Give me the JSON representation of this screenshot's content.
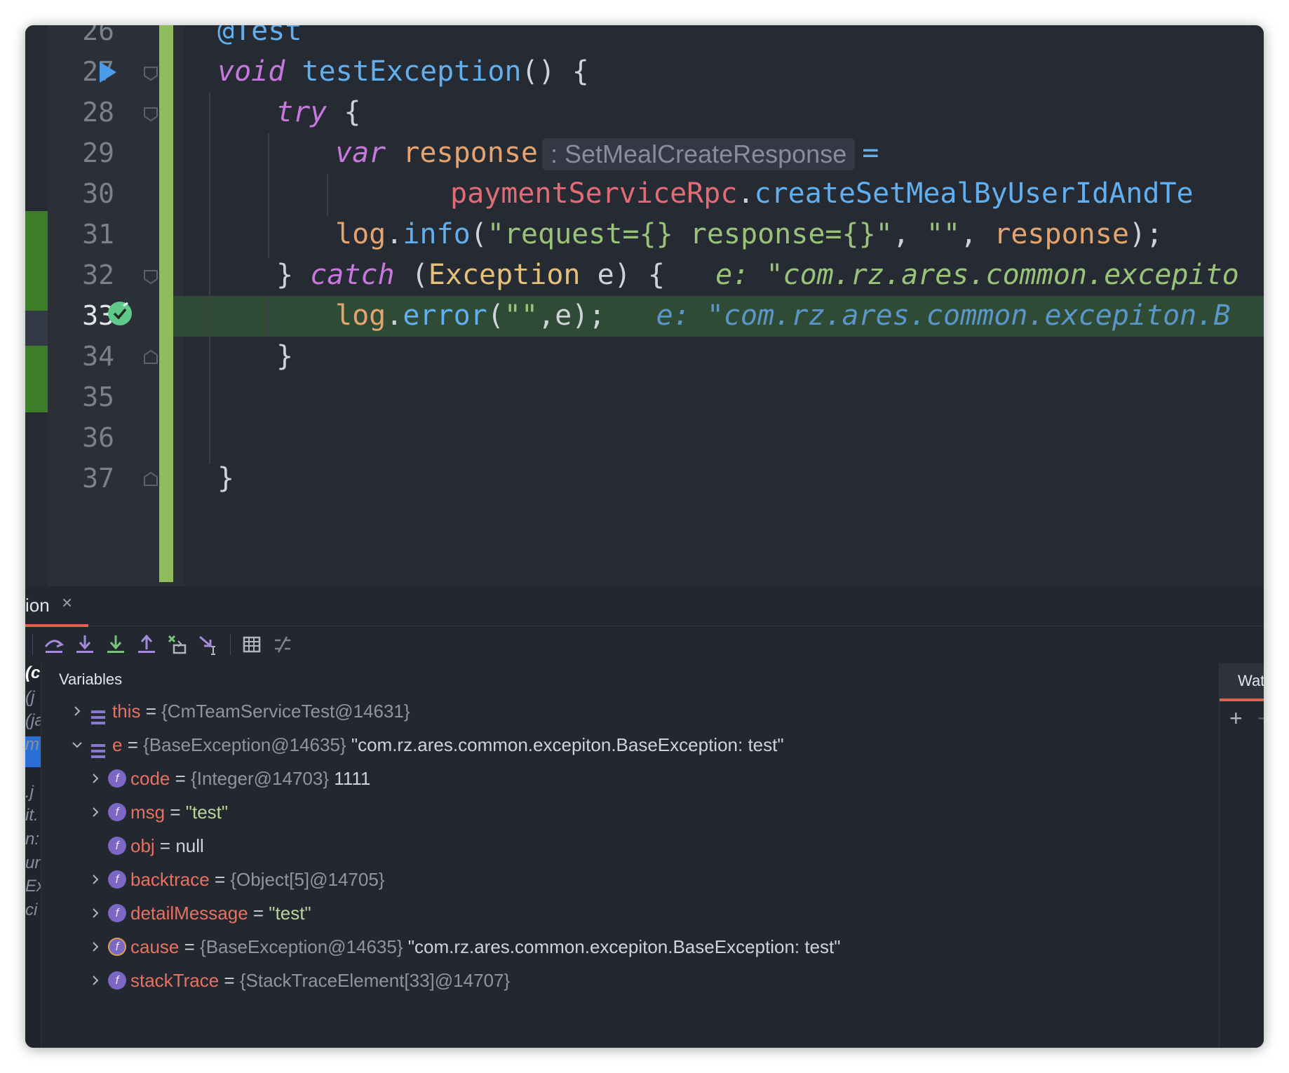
{
  "editor": {
    "lines": [
      {
        "num": "26",
        "tokens": [
          {
            "t": "@Test",
            "c": "ann"
          }
        ]
      },
      {
        "num": "27",
        "tokens": [
          {
            "t": "void",
            "c": "kw"
          },
          {
            "t": " ",
            "c": "punct"
          },
          {
            "t": "testException",
            "c": "fn"
          },
          {
            "t": "() {",
            "c": "punct"
          }
        ]
      },
      {
        "num": "28",
        "tokens": [
          {
            "t": "try",
            "c": "kw"
          },
          {
            "t": " {",
            "c": "punct"
          }
        ]
      },
      {
        "num": "29",
        "tokens": [
          {
            "t": "var",
            "c": "kw"
          },
          {
            "t": " ",
            "c": "punct"
          },
          {
            "t": "response",
            "c": "var"
          }
        ],
        "type_hint": ": SetMealCreateResponse",
        "after_hint": "=",
        "after_hint_color": "#61afef"
      },
      {
        "num": "30",
        "tokens": [
          {
            "t": "paymentServiceRpc",
            "c": "field"
          },
          {
            "t": ".",
            "c": "punct"
          },
          {
            "t": "createSetMealByUserIdAndTe",
            "c": "fn"
          }
        ]
      },
      {
        "num": "31",
        "tokens": [
          {
            "t": "log",
            "c": "var"
          },
          {
            "t": ".",
            "c": "punct"
          },
          {
            "t": "info",
            "c": "fn"
          },
          {
            "t": "(",
            "c": "punct"
          },
          {
            "t": "\"request={} response={}\"",
            "c": "str"
          },
          {
            "t": ", ",
            "c": "punct"
          },
          {
            "t": "\"\"",
            "c": "str"
          },
          {
            "t": ", ",
            "c": "punct"
          },
          {
            "t": "response",
            "c": "var"
          },
          {
            "t": ");",
            "c": "punct"
          }
        ]
      },
      {
        "num": "32",
        "tokens": [
          {
            "t": "} ",
            "c": "punct"
          },
          {
            "t": "catch",
            "c": "kw"
          },
          {
            "t": " (",
            "c": "punct"
          },
          {
            "t": "Exception",
            "c": "cls"
          },
          {
            "t": " e) {",
            "c": "punct"
          },
          {
            "t": "   e: \"com.rz.ares.common.excepito",
            "c": "hint-inline"
          }
        ]
      },
      {
        "num": "33",
        "tokens": [
          {
            "t": "log",
            "c": "var"
          },
          {
            "t": ".",
            "c": "punct"
          },
          {
            "t": "error",
            "c": "fn"
          },
          {
            "t": "(",
            "c": "punct"
          },
          {
            "t": "\"\"",
            "c": "str"
          },
          {
            "t": ",e);",
            "c": "punct"
          },
          {
            "t": "   e: \"com.rz.ares.common.excepiton.B",
            "c": "hint-blue"
          }
        ]
      },
      {
        "num": "34",
        "tokens": [
          {
            "t": "}",
            "c": "punct"
          }
        ]
      },
      {
        "num": "35",
        "tokens": []
      },
      {
        "num": "36",
        "tokens": []
      },
      {
        "num": "37",
        "tokens": [
          {
            "t": "}",
            "c": "punct"
          }
        ]
      }
    ]
  },
  "debug": {
    "tab_label": "ion",
    "tab_close": "×",
    "toolbar": [
      "step-over-icon",
      "step-into-icon",
      "force-step-into-icon",
      "step-out-icon",
      "drop-frame-icon",
      "run-to-cursor-icon",
      "evaluate-table-icon",
      "trace-stream-icon"
    ],
    "variables_header": "Variables",
    "rail_fragments": [
      "(c",
      "(j",
      "(ja",
      "m",
      ".j",
      "it.",
      "n:",
      "un",
      "Ex",
      "ci"
    ],
    "variables": [
      {
        "level": 0,
        "expandable": true,
        "expanded": false,
        "icon": "lines",
        "name": "this",
        "eq": " = ",
        "obj": "{CmTeamServiceTest@14631}",
        "value": "",
        "value_kind": "plain"
      },
      {
        "level": 0,
        "expandable": true,
        "expanded": true,
        "icon": "lines",
        "name": "e",
        "eq": " = ",
        "obj": "{BaseException@14635}",
        "value": " \"com.rz.ares.common.excepiton.BaseException: test\"",
        "value_kind": "plain"
      },
      {
        "level": 1,
        "expandable": true,
        "expanded": false,
        "icon": "field",
        "name": "code",
        "eq": " = ",
        "obj": "{Integer@14703}",
        "value": " 1111",
        "value_kind": "plain"
      },
      {
        "level": 1,
        "expandable": true,
        "expanded": false,
        "icon": "field",
        "name": "msg",
        "eq": " = ",
        "obj": "",
        "value": "\"test\"",
        "value_kind": "str"
      },
      {
        "level": 1,
        "expandable": false,
        "expanded": false,
        "icon": "field",
        "name": "obj",
        "eq": " = ",
        "obj": "",
        "value": "null",
        "value_kind": "plain"
      },
      {
        "level": 1,
        "expandable": true,
        "expanded": false,
        "icon": "field",
        "name": "backtrace",
        "eq": " = ",
        "obj": "{Object[5]@14705}",
        "value": "",
        "value_kind": "plain"
      },
      {
        "level": 1,
        "expandable": true,
        "expanded": false,
        "icon": "field",
        "name": "detailMessage",
        "eq": " = ",
        "obj": "",
        "value": "\"test\"",
        "value_kind": "str"
      },
      {
        "level": 1,
        "expandable": true,
        "expanded": false,
        "icon": "field-alt",
        "name": "cause",
        "eq": " = ",
        "obj": "{BaseException@14635}",
        "value": " \"com.rz.ares.common.excepiton.BaseException: test\"",
        "value_kind": "plain"
      },
      {
        "level": 1,
        "expandable": true,
        "expanded": false,
        "icon": "field",
        "name": "stackTrace",
        "eq": " = ",
        "obj": "{StackTraceElement[33]@14707}",
        "value": "",
        "value_kind": "plain"
      }
    ],
    "field_icon_letter": "f",
    "watches_label": "Watches",
    "watch_add": "+",
    "watch_remove": "−"
  },
  "colors": {
    "editor_bg": "#262a33",
    "current_line": "#2f4b35",
    "vcs_added": "#8fbc5c",
    "accent_tab": "#e0624a",
    "breakpoint": "#5fc98a"
  }
}
